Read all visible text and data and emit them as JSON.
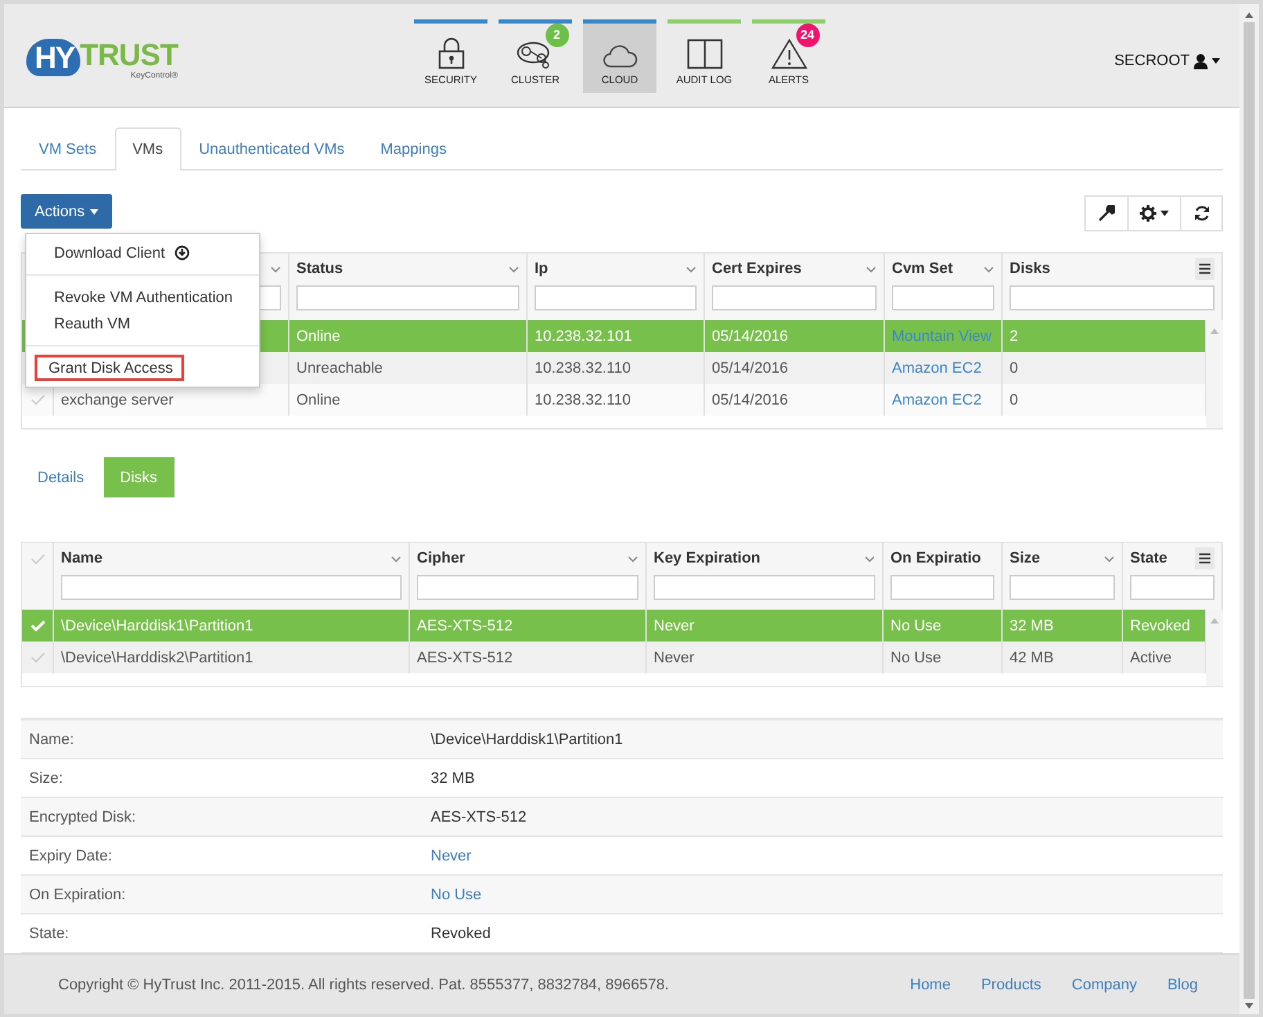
{
  "header": {
    "logo": {
      "mark": "HY",
      "word": "TRUST",
      "product": "KeyControl®"
    },
    "nav": [
      {
        "label": "SECURITY",
        "kind": "lock",
        "color": "#3a87c8",
        "selected": false
      },
      {
        "label": "CLUSTER",
        "kind": "cluster",
        "color": "#3a87c8",
        "selected": false,
        "badge": {
          "text": "2",
          "color": "#6cc04a"
        }
      },
      {
        "label": "CLOUD",
        "kind": "cloud",
        "color": "#3a87c8",
        "selected": true
      },
      {
        "label": "AUDIT LOG",
        "kind": "book",
        "color": "#8dcf6a",
        "selected": false
      },
      {
        "label": "ALERTS",
        "kind": "warning",
        "color": "#8dcf6a",
        "selected": false,
        "badge": {
          "text": "24",
          "color": "#f0146c"
        }
      }
    ],
    "user": "SECROOT"
  },
  "tabs": [
    {
      "label": "VM Sets",
      "selected": false
    },
    {
      "label": "VMs",
      "selected": true
    },
    {
      "label": "Unauthenticated VMs",
      "selected": false
    },
    {
      "label": "Mappings",
      "selected": false
    }
  ],
  "actions": {
    "label": "Actions",
    "menu": [
      [
        {
          "label": "Download Client",
          "kind": "download",
          "highlighted": false
        }
      ],
      [
        {
          "label": "Revoke VM Authentication",
          "kind": "plain",
          "highlighted": false
        },
        {
          "label": "Reauth VM",
          "kind": "plain",
          "highlighted": false
        }
      ],
      [
        {
          "label": "Grant Disk Access",
          "kind": "plain",
          "highlighted": true
        }
      ]
    ]
  },
  "vm_table": {
    "columns": [
      "Status",
      "Ip",
      "Cert Expires",
      "Cvm Set",
      "Disks"
    ],
    "rows": [
      {
        "selected": true,
        "status": "Online",
        "ip": "10.238.32.101",
        "cert_expires": "05/14/2016",
        "cvm_set": "Mountain View",
        "disks": "2"
      },
      {
        "selected": false,
        "status": "Unreachable",
        "ip": "10.238.32.110",
        "cert_expires": "05/14/2016",
        "cvm_set": "Amazon EC2",
        "disks": "0"
      },
      {
        "selected": false,
        "name": "exchange server",
        "status": "Online",
        "ip": "10.238.32.110",
        "cert_expires": "05/14/2016",
        "cvm_set": "Amazon EC2",
        "disks": "0"
      }
    ]
  },
  "detail_tabs": [
    {
      "label": "Details",
      "selected": false
    },
    {
      "label": "Disks",
      "selected": true
    }
  ],
  "disk_table": {
    "all_checked": false,
    "columns": [
      "Name",
      "Cipher",
      "Key Expiration",
      "On Expiratio",
      "Size",
      "State"
    ],
    "rows": [
      {
        "selected": true,
        "cells": [
          "\\Device\\Harddisk1\\Partition1",
          "AES-XTS-512",
          "Never",
          "No Use",
          "32 MB",
          "Revoked"
        ]
      },
      {
        "selected": false,
        "cells": [
          "\\Device\\Harddisk2\\Partition1",
          "AES-XTS-512",
          "Never",
          "No Use",
          "42 MB",
          "Active"
        ]
      }
    ]
  },
  "details": [
    {
      "label": "Name:",
      "value": "\\Device\\Harddisk1\\Partition1",
      "link": false
    },
    {
      "label": "Size:",
      "value": "32 MB",
      "link": false
    },
    {
      "label": "Encrypted Disk:",
      "value": "AES-XTS-512",
      "link": false
    },
    {
      "label": "Expiry Date:",
      "value": "Never",
      "link": true
    },
    {
      "label": "On Expiration:",
      "value": "No Use",
      "link": true
    },
    {
      "label": "State:",
      "value": "Revoked",
      "link": false
    }
  ],
  "footer": {
    "copyright": "Copyright © HyTrust Inc. 2011-2015. All rights reserved. Pat. 8555377, 8832784, 8966578.",
    "links": [
      "Home",
      "Products",
      "Company",
      "Blog"
    ]
  }
}
